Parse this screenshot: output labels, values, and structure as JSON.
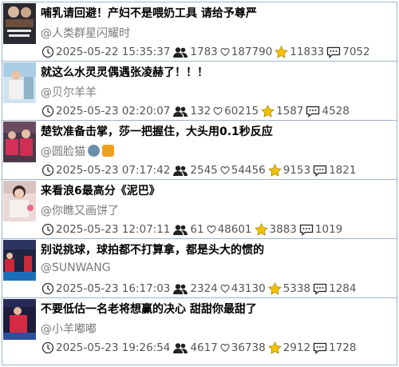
{
  "posts": [
    {
      "title": "哺乳请回避！产妇不是喂奶工具 请给予尊严",
      "author": "@人类群星闪耀时",
      "time": "2025-05-22 15:35:37",
      "users": "1783",
      "likes": "187790",
      "stars": "11833",
      "comments": "7052"
    },
    {
      "title": "就这么水灵灵偶遇张凌赫了！！！",
      "author": "@贝尔羊羊",
      "time": "2025-05-23 02:20:07",
      "users": "132",
      "likes": "60215",
      "stars": "1587",
      "comments": "4528"
    },
    {
      "title": "楚钦准备击掌，莎一把握住，大头用0.1秒反应",
      "author": "@圆脸猫",
      "time": "2025-05-23 07:17:42",
      "users": "2545",
      "likes": "54456",
      "stars": "9153",
      "comments": "1821"
    },
    {
      "title": "来看浪6最高分《泥巴》",
      "author": "@你瞧又画饼了",
      "time": "2025-05-23 12:07:11",
      "users": "61",
      "likes": "48601",
      "stars": "3883",
      "comments": "1019"
    },
    {
      "title": "别说挑球，球拍都不打算拿，都是头大的惯的",
      "author": "@SUNWANG",
      "time": "2025-05-23 16:17:03",
      "users": "2324",
      "likes": "43130",
      "stars": "5338",
      "comments": "1284"
    },
    {
      "title": "不要低估一名老将想赢的决心 甜甜你最甜了",
      "author": "@小羊嘟嘟",
      "time": "2025-05-23 19:26:54",
      "users": "4617",
      "likes": "36738",
      "stars": "2912",
      "comments": "1728"
    }
  ],
  "icons": {
    "time": "clock-icon",
    "users": "users-icon",
    "likes": "heart-icon",
    "stars": "star-icon",
    "comments": "comment-icon"
  },
  "colors": {
    "border": "#9fb4c8",
    "meta_text": "#555555",
    "author_text": "#7a7a7a",
    "star": "#f2c200"
  }
}
